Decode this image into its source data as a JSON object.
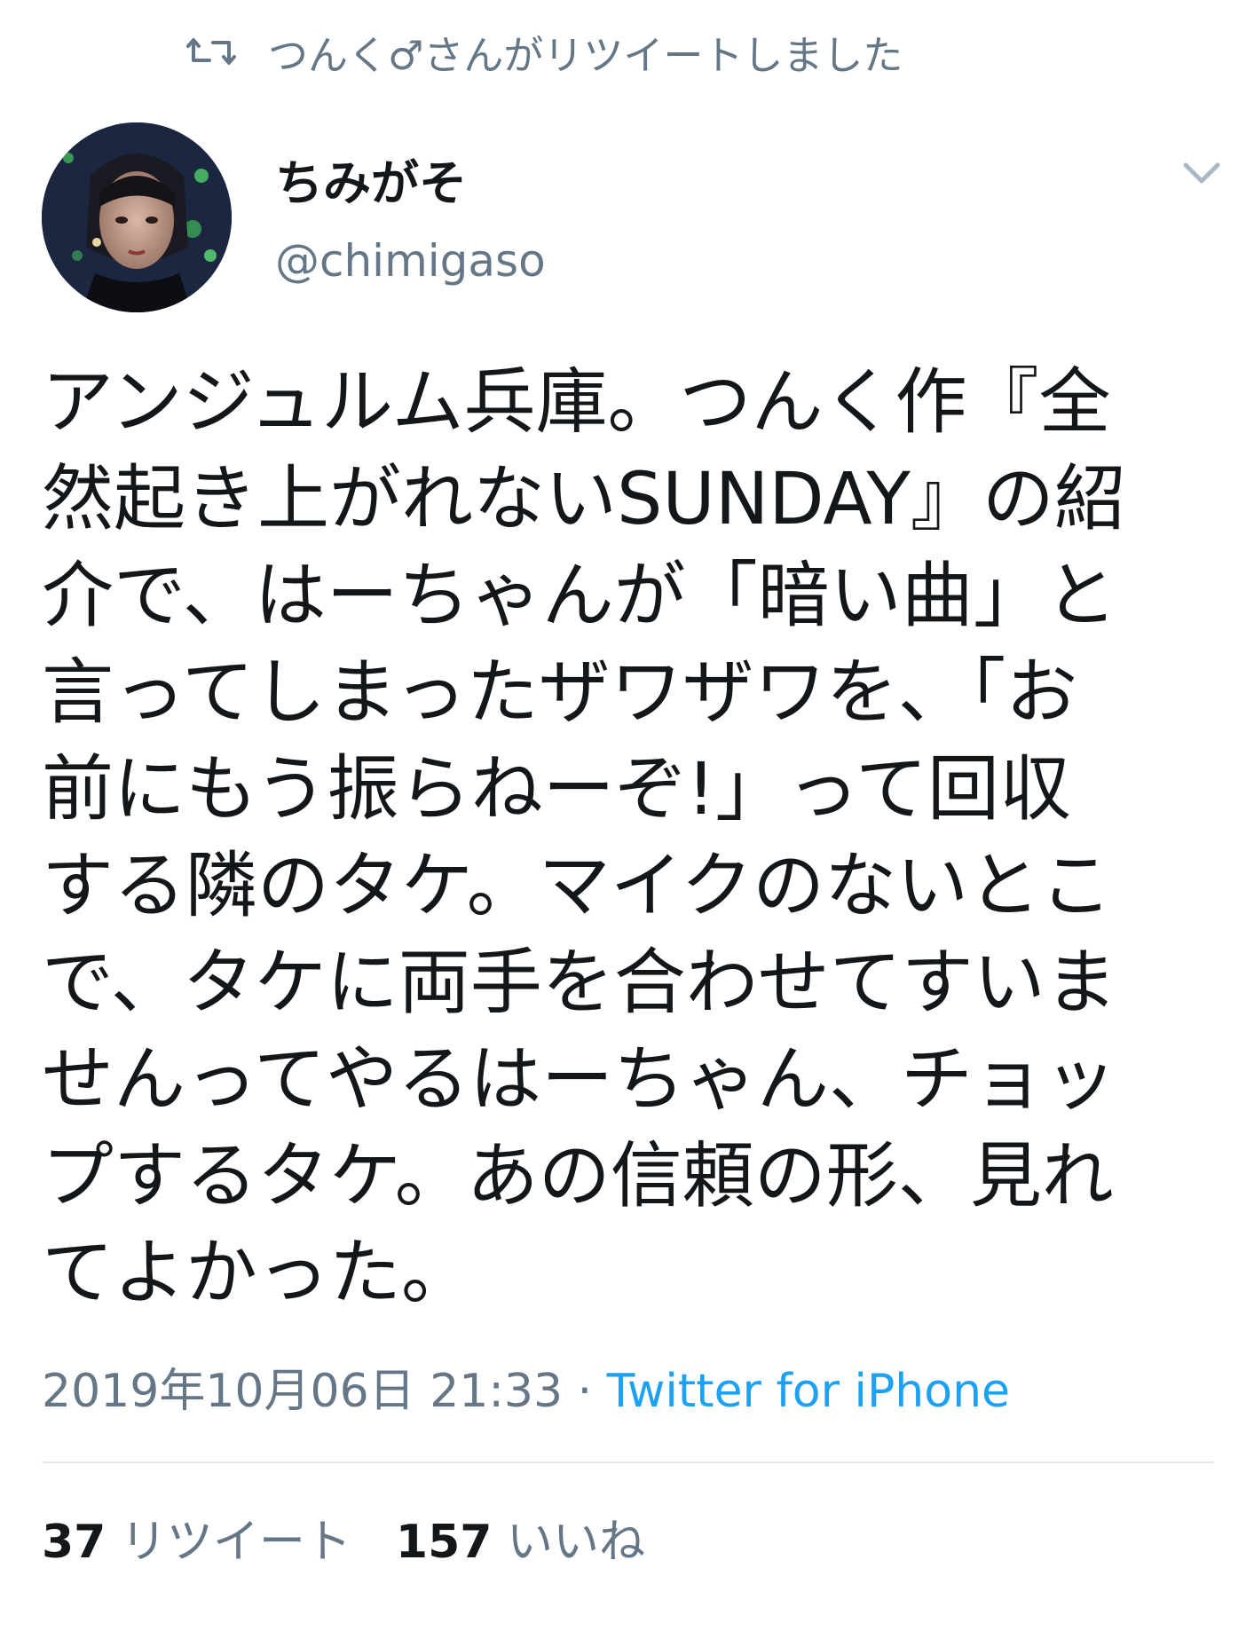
{
  "retweet_banner": {
    "icon": "retweet-icon",
    "text": "つんく♂さんがリツイートしました"
  },
  "author": {
    "avatar": "avatar-photo",
    "display_name": "ちみがそ",
    "handle": "@chimigaso"
  },
  "menu_icon": "chevron-down-icon",
  "tweet": {
    "lines": [
      "アンジュルム兵庫。つんく作『全",
      "然起き上がれないSUNDAY』の紹",
      "介で、はーちゃんが「暗い曲」と",
      "言ってしまったザワザワを、「お",
      "前にもう振らねーぞ!」って回収",
      "する隣のタケ。マイクのないとこ",
      "で、タケに両手を合わせてすいま",
      "せんってやるはーちゃん、チョッ",
      "プするタケ。あの信頼の形、見れ",
      "てよかった。"
    ]
  },
  "meta": {
    "timestamp": "2019年10月06日 21:33",
    "separator": " · ",
    "source": "Twitter for iPhone"
  },
  "stats": {
    "retweet_count": "37",
    "retweet_label": "リツイート",
    "like_count": "157",
    "like_label": "いいね"
  },
  "colors": {
    "text": "#14171a",
    "secondary": "#657786",
    "link": "#1da1f2",
    "divider": "#e1e8ed"
  }
}
